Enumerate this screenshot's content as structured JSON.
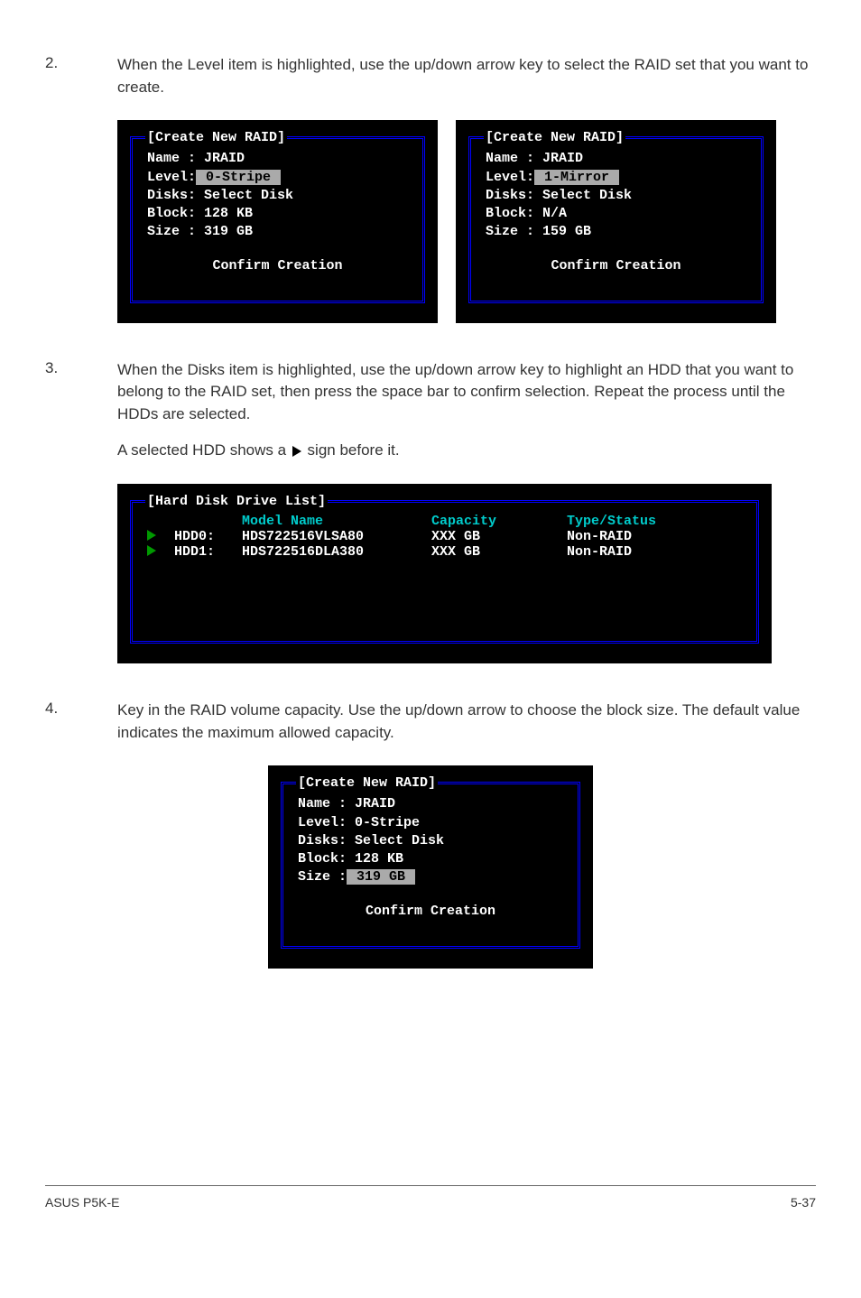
{
  "step2": {
    "num": "2.",
    "text": "When the Level item is highlighted, use the up/down arrow key to select the RAID set that you want to create."
  },
  "panel_a": {
    "title": "[Create New RAID]",
    "name_label": "Name : ",
    "name_value": "JRAID",
    "level_label": "Level:",
    "level_value": " 0-Stripe ",
    "disks_label": "Disks: ",
    "disks_value": "Select Disk",
    "block_label": "Block: ",
    "block_value": "128 KB",
    "size_label": "Size : ",
    "size_value": "319 GB",
    "confirm": "Confirm Creation"
  },
  "panel_b": {
    "title": "[Create New RAID]",
    "name_label": "Name : ",
    "name_value": "JRAID",
    "level_label": "Level:",
    "level_value": " 1-Mirror ",
    "disks_label": "Disks: ",
    "disks_value": "Select Disk",
    "block_label": "Block: ",
    "block_value": "N/A",
    "size_label": "Size : ",
    "size_value": "159 GB",
    "confirm": "Confirm Creation"
  },
  "step3": {
    "num": "3.",
    "text": "When the Disks item is highlighted, use the up/down arrow key to highlight an HDD that you want to belong to the RAID set, then press the space bar to confirm selection. Repeat the process until the HDDs are selected.",
    "subtext_pre": "A selected HDD shows a ",
    "subtext_post": " sign before it."
  },
  "disk_list": {
    "title": "[Hard Disk Drive List]",
    "hdr_model": "Model Name",
    "hdr_capacity": "Capacity",
    "hdr_status": "Type/Status",
    "rows": [
      {
        "hdd": "HDD0:",
        "model": "HDS722516VLSA80",
        "capacity": "XXX GB",
        "status": "Non-RAID"
      },
      {
        "hdd": "HDD1:",
        "model": "HDS722516DLA380",
        "capacity": "XXX GB",
        "status": "Non-RAID"
      }
    ]
  },
  "step4": {
    "num": "4.",
    "text": "Key in the RAID volume capacity. Use the up/down arrow to choose the block size. The default value indicates the maximum allowed capacity."
  },
  "panel_c": {
    "title": "[Create New RAID]",
    "name_label": "Name : ",
    "name_value": "JRAID",
    "level_label": "Level: ",
    "level_value": "0-Stripe",
    "disks_label": "Disks: ",
    "disks_value": "Select Disk",
    "block_label": "Block: ",
    "block_value": "128 KB",
    "size_label": "Size :",
    "size_value": " 319 GB ",
    "confirm": "Confirm Creation"
  },
  "footer": {
    "left": "ASUS P5K-E",
    "right": "5-37"
  }
}
